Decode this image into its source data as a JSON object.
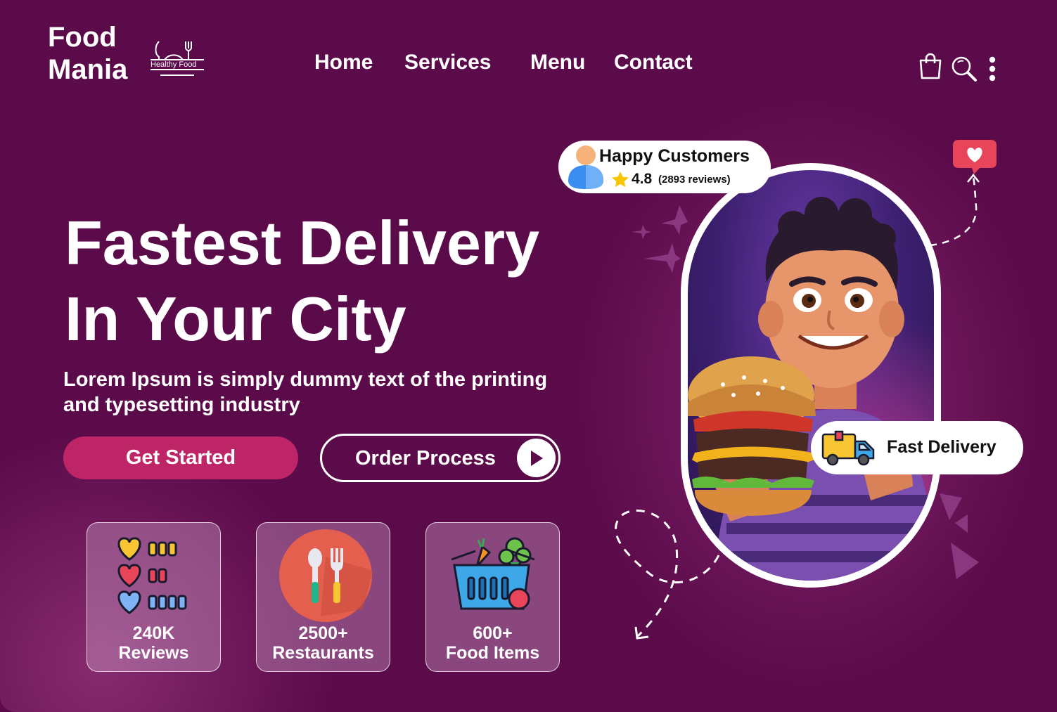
{
  "brand": {
    "name_line1": "Food",
    "name_line2": "Mania",
    "tagline": "Healthy Food"
  },
  "nav": {
    "items": [
      {
        "label": "Home"
      },
      {
        "label": "Services"
      },
      {
        "label": "Menu"
      },
      {
        "label": "Contact"
      }
    ]
  },
  "header_icons": [
    "shopping-bag-icon",
    "search-icon",
    "more-vertical-icon"
  ],
  "hero": {
    "title_line1": "Fastest Delivery",
    "title_line2": "In Your City",
    "subtitle": "Lorem Ipsum is simply dummy text of the printing and typesetting industry",
    "primary_cta": "Get Started",
    "secondary_cta": "Order Process"
  },
  "stats": [
    {
      "value": "240K",
      "caption": "Reviews",
      "icon": "hearts-rating-icon"
    },
    {
      "value": "2500+",
      "caption": "Restaurants",
      "icon": "spoon-fork-icon"
    },
    {
      "value": "600+",
      "caption": "Food Items",
      "icon": "grocery-basket-icon"
    }
  ],
  "badges": {
    "happy_customers": {
      "title": "Happy Customers",
      "rating": "4.8",
      "reviews": "(2893 reviews)"
    },
    "fast_delivery": {
      "title": "Fast Delivery"
    }
  },
  "colors": {
    "background": "#5c0b4a",
    "primary_button": "#be2566",
    "text": "#ffffff",
    "star": "#f7c600",
    "heart_bubble": "#e8445a"
  }
}
